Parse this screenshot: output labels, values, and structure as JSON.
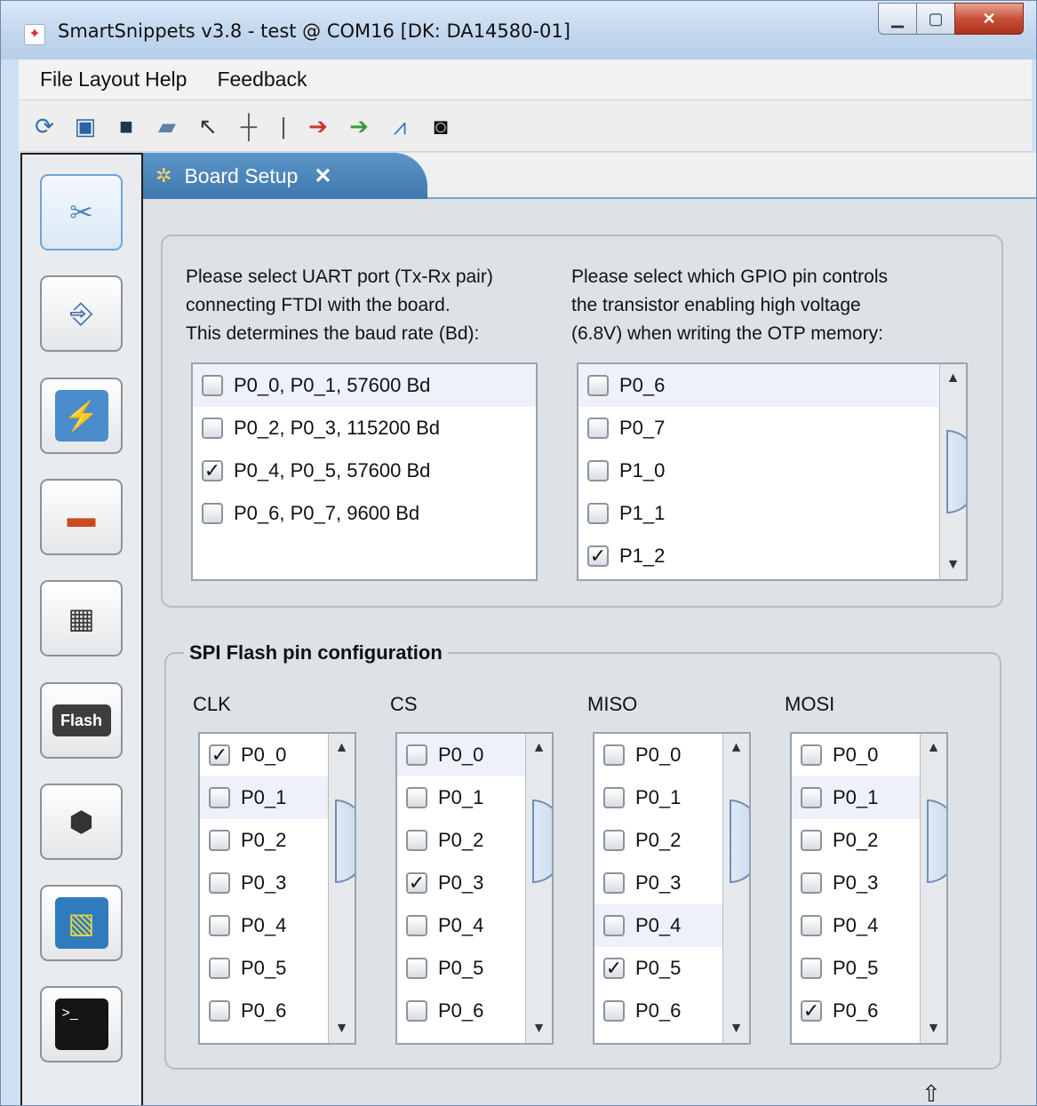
{
  "window": {
    "title": "SmartSnippets v3.8 - test @ COM16  [DK: DA14580-01]",
    "controls": [
      "minimize",
      "maximize",
      "close"
    ]
  },
  "menu": [
    "File",
    "Layout",
    "Help",
    "Feedback"
  ],
  "toolbar": [
    "refresh-icon",
    "save-icon",
    "window-icon",
    "open-folder-icon",
    "pointer-icon",
    "crosshair-icon",
    "line-cursor-icon",
    "export-red-icon",
    "import-green-icon",
    "chart-icon",
    "camera-icon"
  ],
  "sidebar": {
    "items": [
      "board-setup-tools-icon",
      "connection-icon",
      "power-profiler-icon",
      "battery-icon",
      "chip-programmer-icon",
      "flash-icon",
      "eeprom-icon",
      "layout-icon",
      "terminal-icon"
    ],
    "flash_label": "Flash"
  },
  "tab": {
    "label": "Board Setup",
    "close": "✕"
  },
  "uart": {
    "description": "Please select UART port (Tx-Rx pair)\nconnecting FTDI with the board.\nThis determines the baud rate (Bd):",
    "options": [
      {
        "label": "P0_0, P0_1, 57600 Bd",
        "checked": false
      },
      {
        "label": "P0_2, P0_3, 115200 Bd",
        "checked": false
      },
      {
        "label": "P0_4, P0_5, 57600 Bd",
        "checked": true
      },
      {
        "label": "P0_6, P0_7, 9600 Bd",
        "checked": false
      }
    ]
  },
  "gpio": {
    "description": "Please select which GPIO pin controls\nthe transistor enabling high voltage\n(6.8V) when writing the OTP memory:",
    "options": [
      {
        "label": "P0_6",
        "checked": false
      },
      {
        "label": "P0_7",
        "checked": false
      },
      {
        "label": "P1_0",
        "checked": false
      },
      {
        "label": "P1_1",
        "checked": false
      },
      {
        "label": "P1_2",
        "checked": true
      }
    ]
  },
  "spi": {
    "title": "SPI Flash pin configuration",
    "columns": [
      {
        "name": "CLK",
        "checked_index": 0,
        "highlight_index": 1
      },
      {
        "name": "CS",
        "checked_index": 3,
        "highlight_index": 0
      },
      {
        "name": "MISO",
        "checked_index": 5,
        "highlight_index": 4
      },
      {
        "name": "MOSI",
        "checked_index": 6,
        "highlight_index": 1
      }
    ],
    "pins": [
      "P0_0",
      "P0_1",
      "P0_2",
      "P0_3",
      "P0_4",
      "P0_5",
      "P0_6"
    ]
  },
  "checkmark": "✓",
  "colors": {
    "tab_blue": "#4a84b9",
    "panel_bg": "#dde2e7",
    "close_red": "#c75138"
  }
}
